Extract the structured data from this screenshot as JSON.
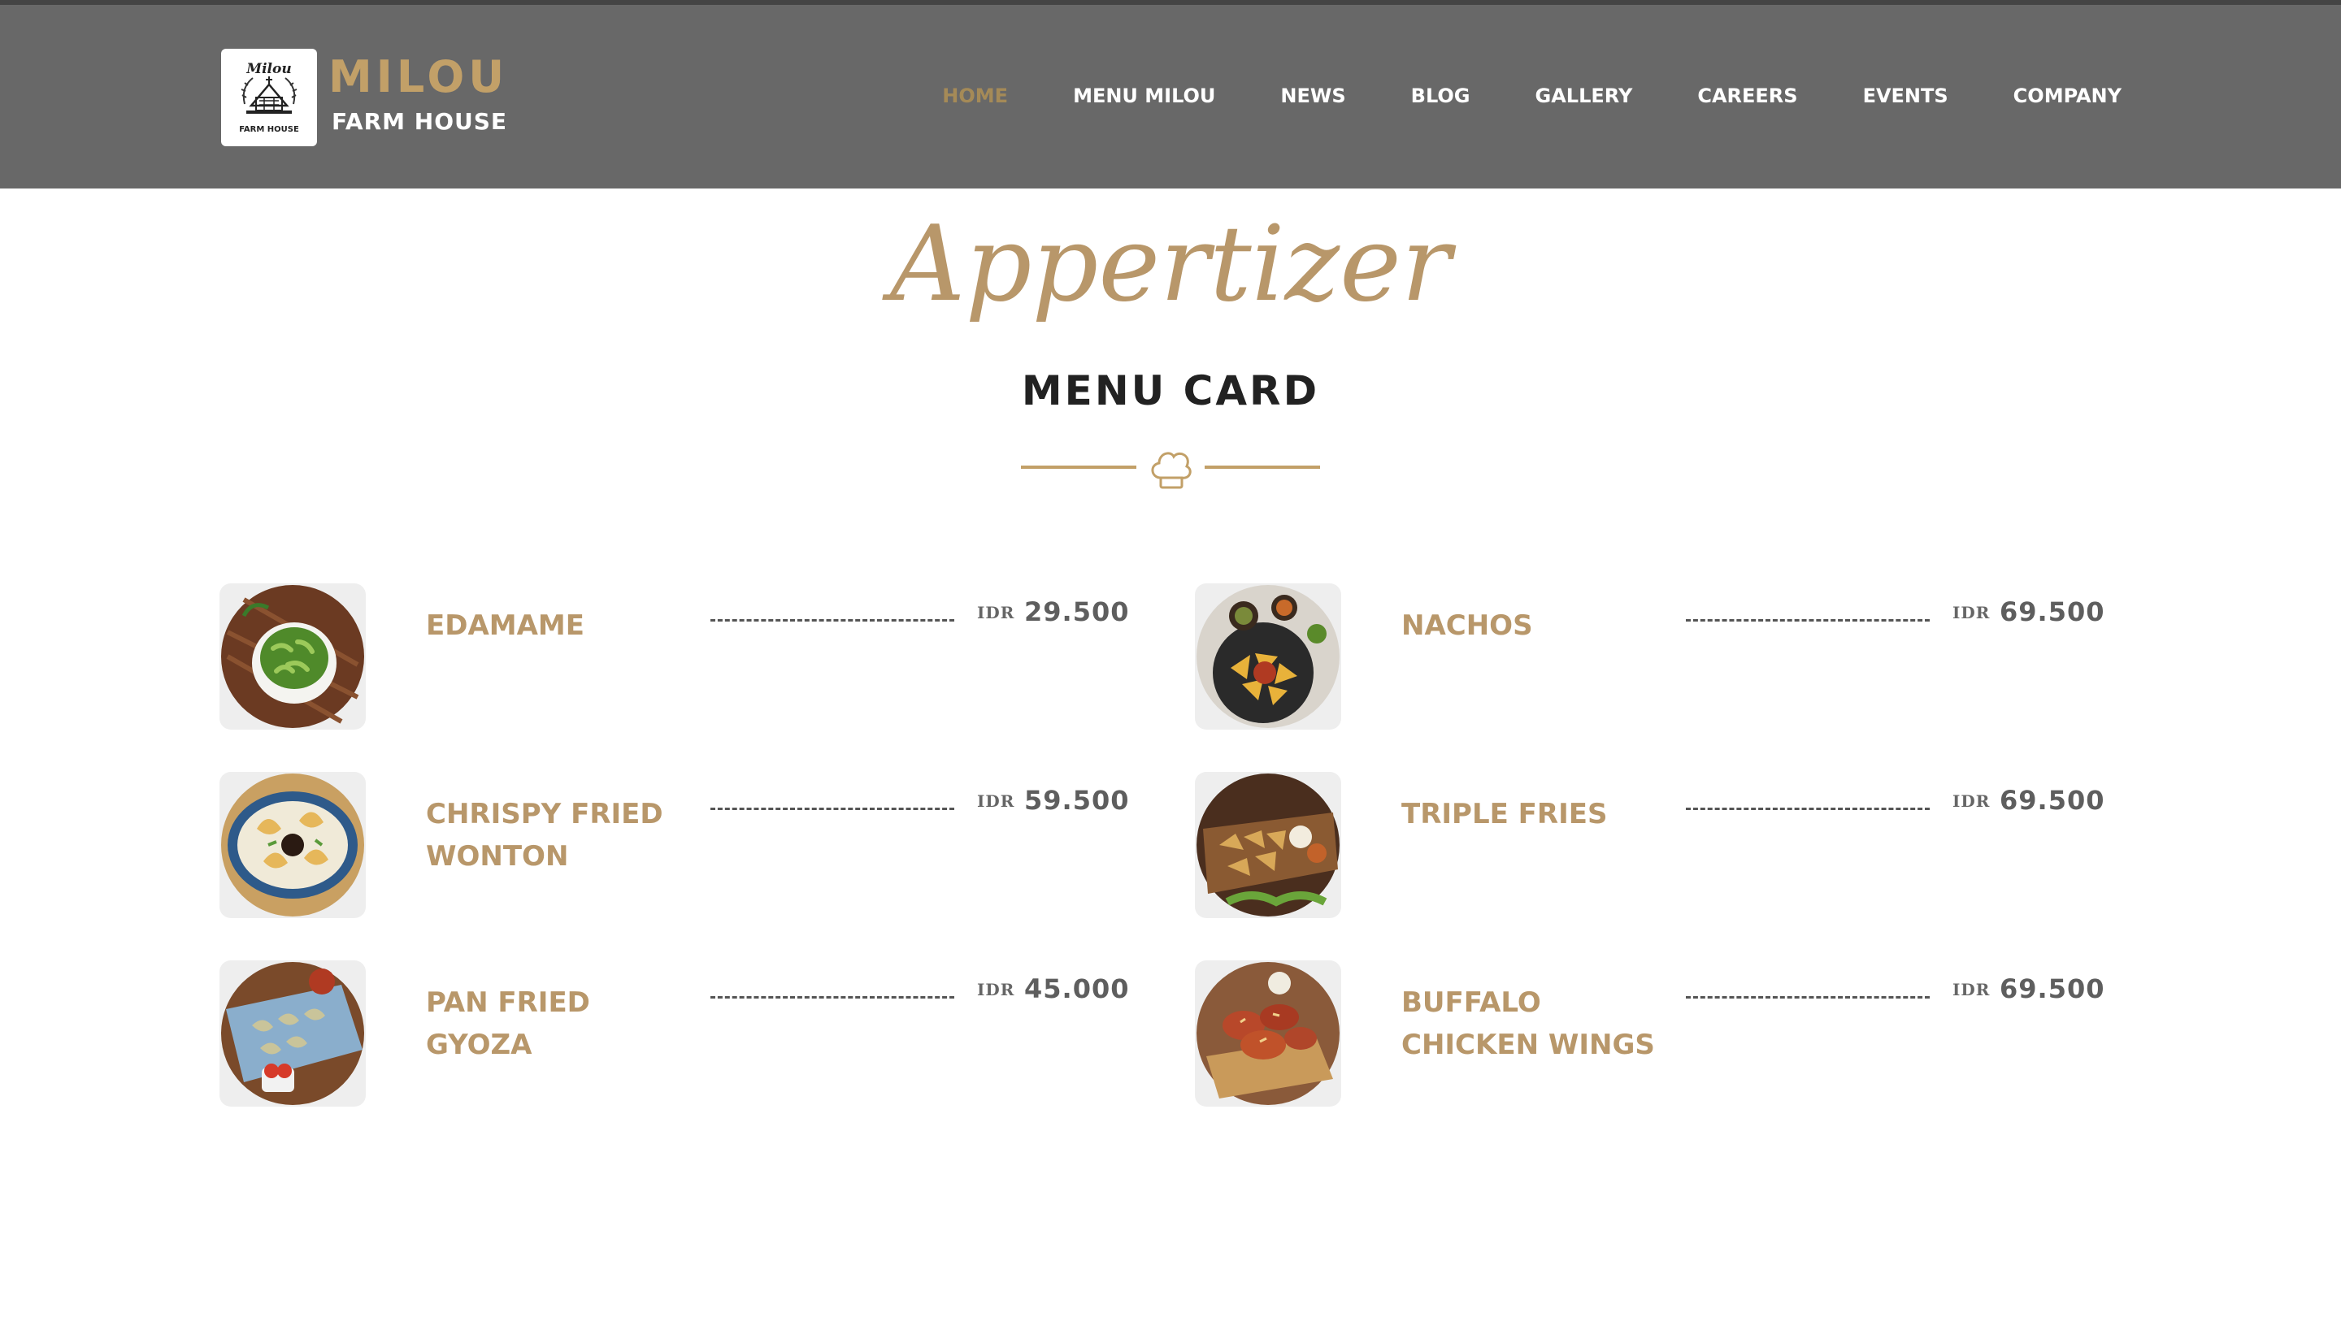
{
  "brand": {
    "logo_icon": "farm-house-logo-icon",
    "name": "MILOU",
    "subtitle": "FARM HOUSE",
    "logo_script": "Milou",
    "logo_caption": "FARM HOUSE"
  },
  "nav": {
    "items": [
      {
        "label": "HOME",
        "active": true
      },
      {
        "label": "MENU MILOU",
        "active": false
      },
      {
        "label": "NEWS",
        "active": false
      },
      {
        "label": "BLOG",
        "active": false
      },
      {
        "label": "GALLERY",
        "active": false
      },
      {
        "label": "CAREERS",
        "active": false
      },
      {
        "label": "EVENTS",
        "active": false
      },
      {
        "label": "COMPANY",
        "active": false
      }
    ]
  },
  "section": {
    "script_title": "Appertizer",
    "title": "MENU CARD",
    "divider_icon": "chef-hat-icon"
  },
  "menu": {
    "currency": "IDR",
    "items": [
      {
        "name": "EDAMAME",
        "price": "29.500",
        "image": "edamame-bowl-image"
      },
      {
        "name": "NACHOS",
        "price": "69.500",
        "image": "nachos-plate-image"
      },
      {
        "name": "CHRISPY FRIED WONTON",
        "price": "59.500",
        "image": "fried-wonton-image"
      },
      {
        "name": "TRIPLE FRIES",
        "price": "69.500",
        "image": "triple-fries-image"
      },
      {
        "name": "PAN FRIED GYOZA",
        "price": "45.000",
        "image": "gyoza-tray-image"
      },
      {
        "name": "BUFFALO CHICKEN WINGS",
        "price": "69.500",
        "image": "chicken-wings-image"
      }
    ]
  },
  "colors": {
    "header_bg": "#686868",
    "accent_gold": "#b8976a",
    "active_nav": "#a58a57",
    "title_dark": "#222222"
  }
}
